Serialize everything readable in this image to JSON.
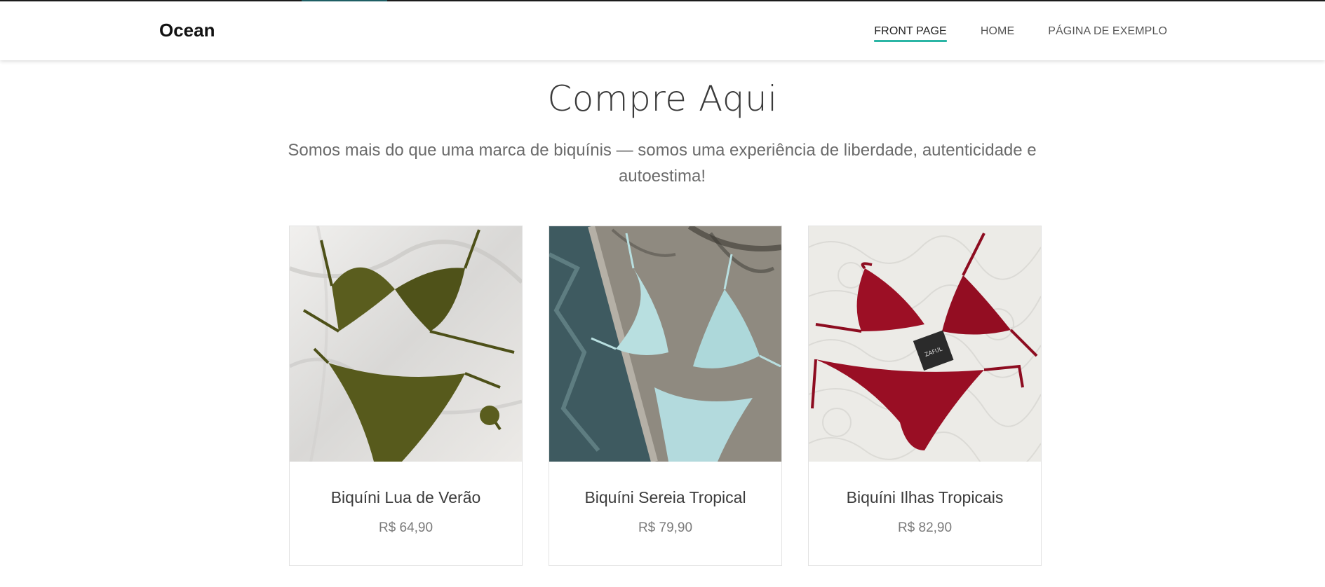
{
  "site": {
    "brand": "Ocean"
  },
  "nav": {
    "items": [
      {
        "label": "FRONT PAGE",
        "active": true
      },
      {
        "label": "HOME",
        "active": false
      },
      {
        "label": "PÁGINA DE EXEMPLO",
        "active": false
      }
    ]
  },
  "hero": {
    "title": "Compre Aqui",
    "subtitle": "Somos mais do que uma marca de biquínis — somos uma experiência de liberdade, autenticidade e autoestima!"
  },
  "products": [
    {
      "name": "Biquíni Lua de Verão",
      "price": "R$ 64,90",
      "image_color": "#5a5d1e"
    },
    {
      "name": "Biquíni Sereia Tropical",
      "price": "R$ 79,90",
      "image_color": "#b8dfe0"
    },
    {
      "name": "Biquíni Ilhas Tropicais",
      "price": "R$ 82,90",
      "image_color": "#9c0f25"
    }
  ],
  "colors": {
    "accent": "#2bb5a5",
    "top_accent": "#1f5f66",
    "text": "#333333"
  }
}
